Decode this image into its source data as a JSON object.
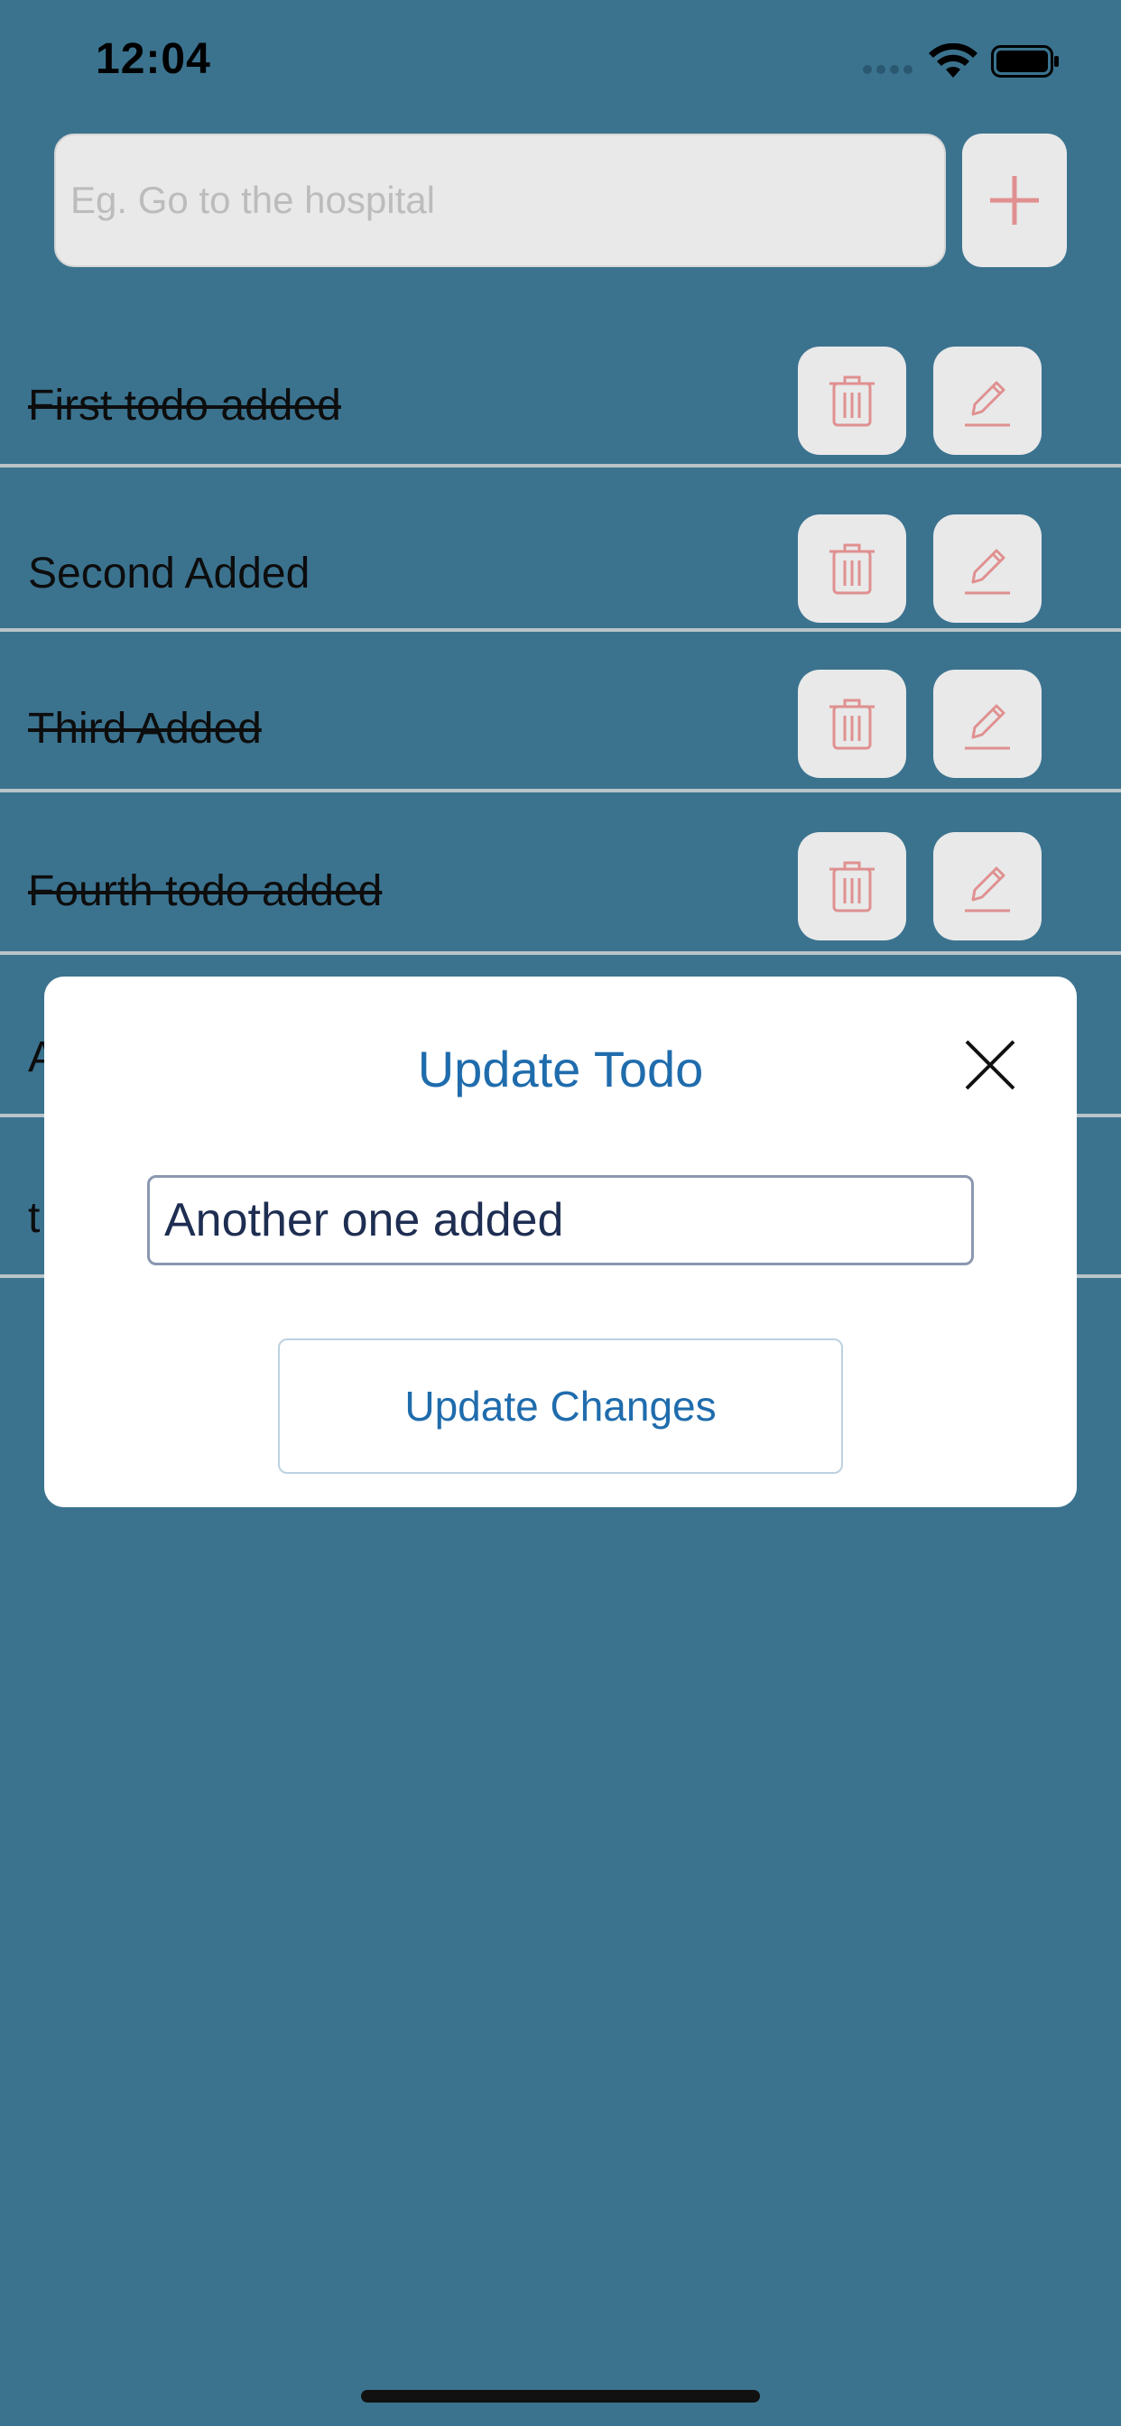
{
  "status_bar": {
    "time": "12:04",
    "icons": [
      "signal-dots-icon",
      "wifi-icon",
      "battery-icon"
    ]
  },
  "add_todo": {
    "placeholder": "Eg. Go to the hospital",
    "value": "",
    "add_icon": "plus-icon"
  },
  "todos": [
    {
      "text": "First todo added",
      "completed": true
    },
    {
      "text": "Second Added",
      "completed": false
    },
    {
      "text": "Third Added",
      "completed": true
    },
    {
      "text": "Fourth todo added",
      "completed": true
    },
    {
      "text": "A",
      "completed": false
    },
    {
      "text": "t",
      "completed": false
    }
  ],
  "row_actions": {
    "delete_icon": "trash-icon",
    "edit_icon": "pencil-icon"
  },
  "modal": {
    "title": "Update Todo",
    "input_value": "Another one added",
    "button_label": "Update Changes",
    "close_icon": "close-icon"
  },
  "colors": {
    "background": "#3b738f",
    "control_bg": "#e9e9e9",
    "icon_accent": "#e09090",
    "modal_accent": "#1f6cad"
  }
}
